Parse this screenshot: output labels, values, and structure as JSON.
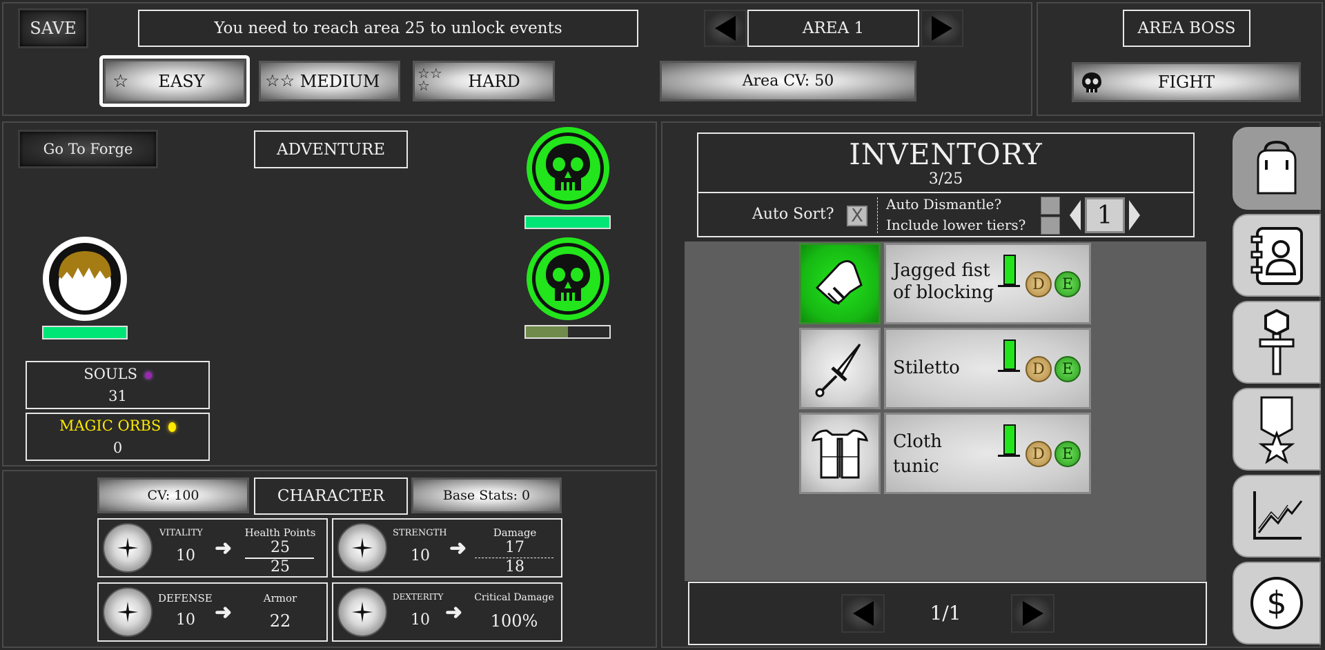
{
  "top": {
    "save_label": "SAVE",
    "events_notice": "You need to reach area 25 to unlock events",
    "area_label": "AREA 1",
    "difficulty": [
      {
        "stars": "☆",
        "label": "EASY",
        "selected": true
      },
      {
        "stars": "☆☆",
        "label": "MEDIUM",
        "selected": false
      },
      {
        "stars": "☆☆☆",
        "label": "HARD",
        "selected": false
      }
    ],
    "area_cv": "Area CV: 50",
    "area_boss_label": "AREA BOSS",
    "fight_label": "FIGHT"
  },
  "adventure": {
    "forge_label": "Go To Forge",
    "title": "ADVENTURE",
    "player_hp": 1.0,
    "enemies": [
      {
        "icon": "skull-icon",
        "hp": 1.0
      },
      {
        "icon": "skull-icon",
        "hp": 0.5
      }
    ],
    "souls_label": "SOULS",
    "souls_value": "31",
    "orbs_label": "MAGIC ORBS",
    "orbs_value": "0"
  },
  "character": {
    "cv": "CV: 100",
    "title": "CHARACTER",
    "base_stats": "Base Stats: 0",
    "stats": [
      {
        "name": "VITALITY",
        "value": "10",
        "result_label": "Health Points",
        "result_top": "25",
        "result_bottom": "25"
      },
      {
        "name": "STRENGTH",
        "value": "10",
        "result_label": "Damage",
        "result_top": "17",
        "result_bottom": "18"
      },
      {
        "name": "DEFENSE",
        "value": "10",
        "result_label": "Armor",
        "result_value": "22"
      },
      {
        "name": "DEXTERITY",
        "value": "10",
        "result_label": "Critical Damage",
        "result_value": "100%"
      }
    ]
  },
  "inventory": {
    "title": "INVENTORY",
    "count": "3/25",
    "auto_sort_label": "Auto Sort?",
    "auto_sort_mark": "X",
    "auto_dismantle_label": "Auto Dismantle?",
    "include_lower_label": "Include lower tiers?",
    "tier_value": "1",
    "items": [
      {
        "name_line1": "Jagged fist",
        "name_line2": "of blocking",
        "icon": "gauntlet-icon",
        "selected": true,
        "dismantle": "D",
        "equip": "E"
      },
      {
        "name_line1": "Stiletto",
        "name_line2": "",
        "icon": "dagger-icon",
        "selected": false,
        "dismantle": "D",
        "equip": "E"
      },
      {
        "name_line1": "Cloth",
        "name_line2": "tunic",
        "icon": "tunic-icon",
        "selected": false,
        "dismantle": "D",
        "equip": "E"
      }
    ],
    "page": "1/1"
  },
  "side_tabs": [
    "backpack-icon",
    "contacts-icon",
    "ankh-icon",
    "medal-icon",
    "chart-icon",
    "dollar-icon"
  ],
  "colors": {
    "accent_green": "#22e51c",
    "hp_green": "#00e676",
    "orbs_yellow": "#ffea00",
    "souls_purple": "#9c27b0"
  }
}
